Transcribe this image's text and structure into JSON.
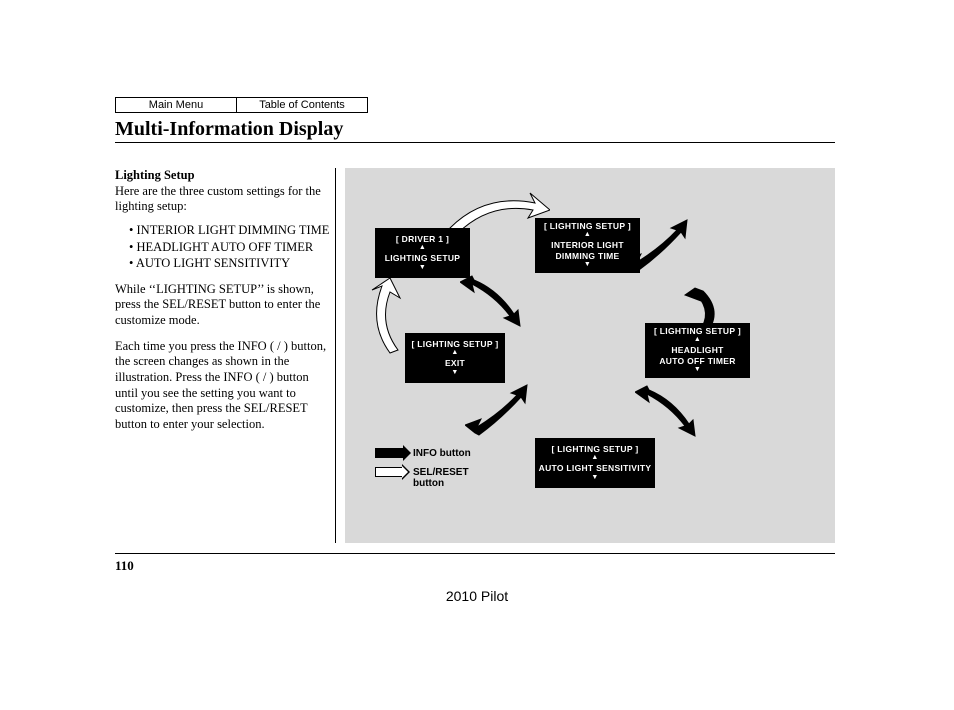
{
  "nav": {
    "main_menu": "Main Menu",
    "toc": "Table of Contents"
  },
  "title": "Multi-Information Display",
  "section": {
    "heading": "Lighting Setup",
    "intro": "Here are the three custom settings for the lighting setup:",
    "bullets": [
      "INTERIOR LIGHT DIMMING TIME",
      "HEADLIGHT AUTO OFF TIMER",
      "AUTO LIGHT SENSITIVITY"
    ],
    "para1": "While ‘‘LIGHTING SETUP’’ is shown, press the SEL/RESET button to enter the customize mode.",
    "para2": "Each time you press the INFO (    /    ) button, the screen changes as shown in the illustration. Press the INFO (    /    ) button until you see the setting you want to customize, then press the SEL/RESET button to enter your selection."
  },
  "screens": {
    "driver1": {
      "header": "[ DRIVER 1 ]",
      "line": "LIGHTING SETUP"
    },
    "dimming": {
      "header": "[ LIGHTING SETUP ]",
      "line1": "INTERIOR LIGHT",
      "line2": "DIMMING TIME"
    },
    "headlight": {
      "header": "[ LIGHTING SETUP ]",
      "line1": "HEADLIGHT",
      "line2": "AUTO OFF TIMER"
    },
    "autolight": {
      "header": "[ LIGHTING SETUP ]",
      "line": "AUTO LIGHT SENSITIVITY"
    },
    "exit": {
      "header": "[ LIGHTING SETUP ]",
      "line": "EXIT"
    }
  },
  "legend": {
    "info": "INFO button",
    "sel": "SEL/RESET button"
  },
  "page_number": "110",
  "footer": "2010 Pilot"
}
